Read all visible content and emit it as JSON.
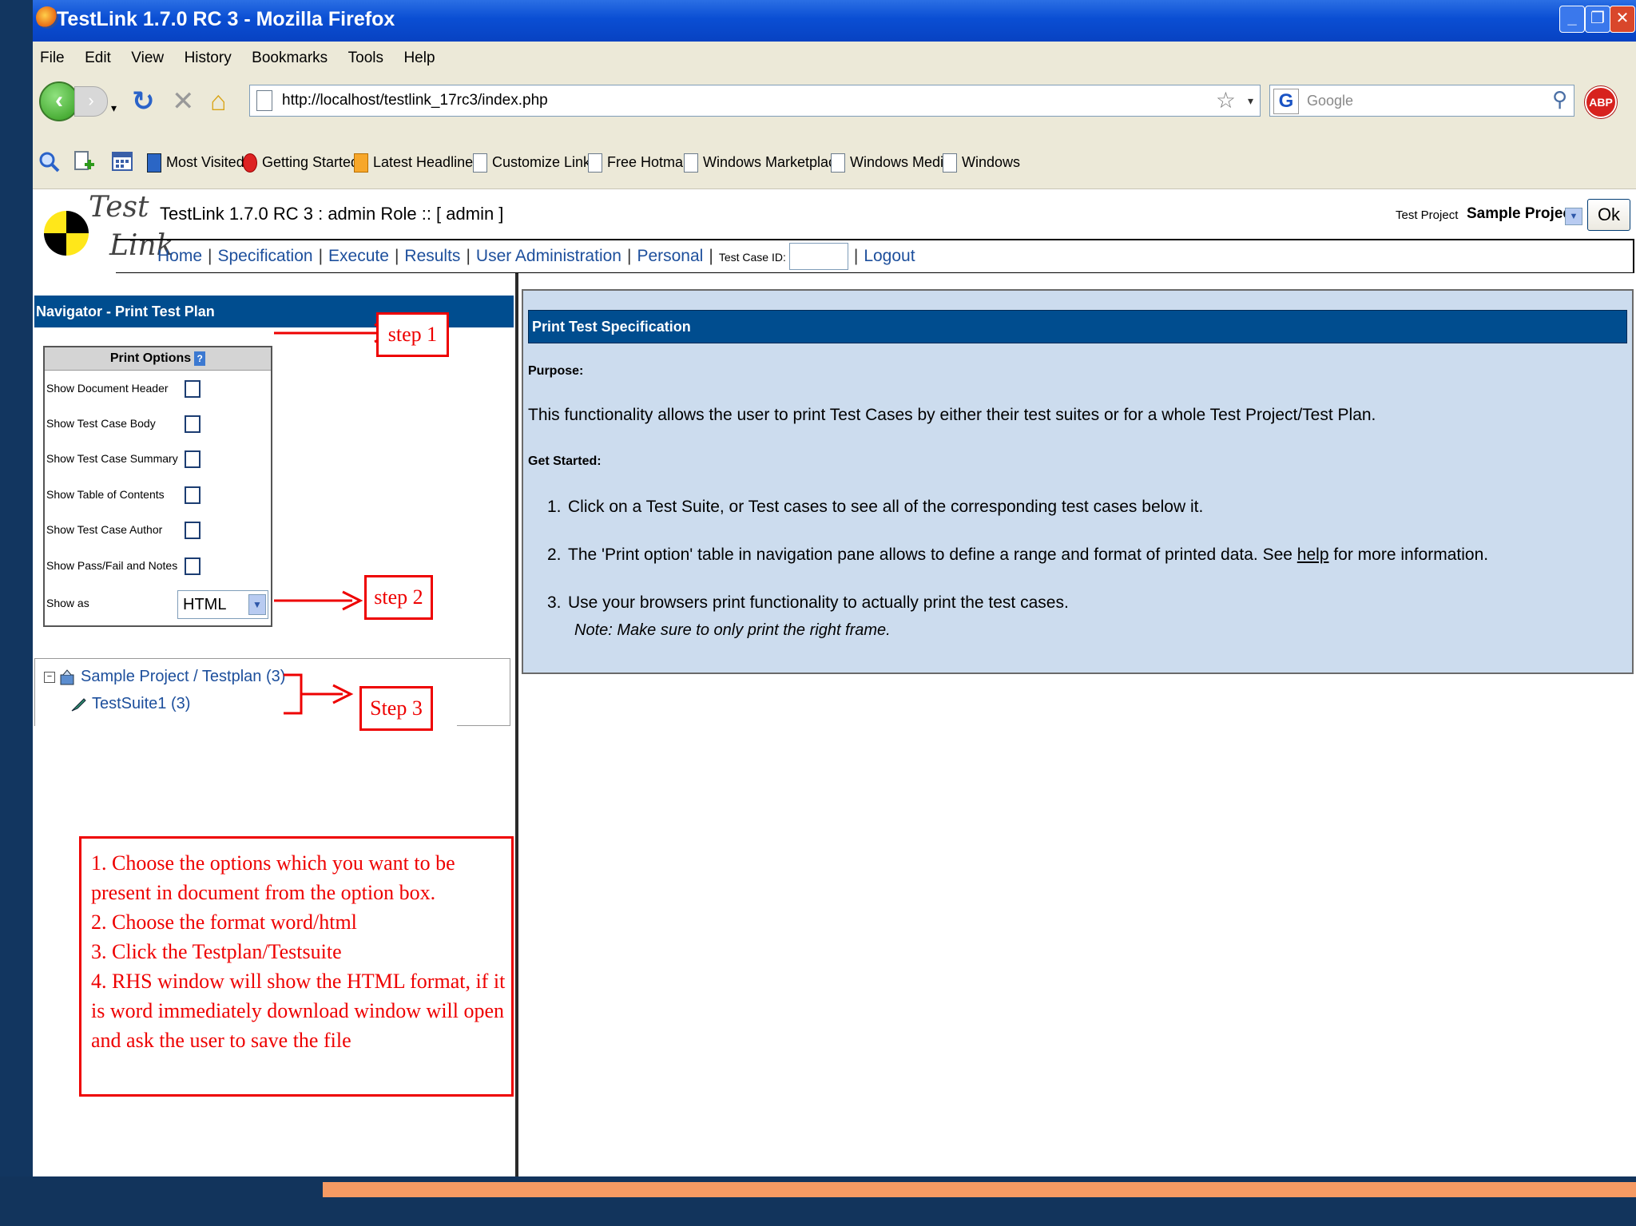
{
  "window": {
    "title": "TestLink 1.7.0 RC 3 - Mozilla Firefox"
  },
  "menubar": [
    "File",
    "Edit",
    "View",
    "History",
    "Bookmarks",
    "Tools",
    "Help"
  ],
  "navbar": {
    "url": "http://localhost/testlink_17rc3/index.php",
    "search_placeholder": "Google",
    "abp_label": "ABP"
  },
  "bookmarks": [
    "Most Visited",
    "Getting Started",
    "Latest Headlines",
    "Customize Links",
    "Free Hotmail",
    "Windows Marketplace",
    "Windows Media",
    "Windows"
  ],
  "testlink": {
    "logo_line1": "Test",
    "logo_line2": "Link",
    "title": "TestLink 1.7.0 RC 3 : admin Role :: [ admin ]",
    "test_project_label": "Test Project",
    "test_project_value": "Sample Project",
    "ok_label": "Ok",
    "menu": {
      "home": "Home",
      "specification": "Specification",
      "execute": "Execute",
      "results": "Results",
      "user_admin": "User Administration",
      "personal": "Personal",
      "test_case_id": "Test Case ID:",
      "logout": "Logout"
    }
  },
  "navigator": {
    "header": "Navigator - Print Test Plan",
    "print_options_title": "Print Options",
    "print_options_help": "?",
    "options": [
      {
        "label": "Show Document Header",
        "checked": false
      },
      {
        "label": "Show Test Case Body",
        "checked": false
      },
      {
        "label": "Show Test Case Summary",
        "checked": false
      },
      {
        "label": "Show Table of Contents",
        "checked": false
      },
      {
        "label": "Show Test Case Author",
        "checked": false
      },
      {
        "label": "Show Pass/Fail and Notes",
        "checked": false
      }
    ],
    "show_as_label": "Show as",
    "show_as_value": "HTML",
    "tree": {
      "root": "Sample Project / Testplan (3)",
      "child": "TestSuite1 (3)"
    }
  },
  "annotations": {
    "step1": "step 1",
    "step2": "step 2",
    "step3": "Step 3",
    "notes": [
      "1. Choose the options which you want to be",
      "present in document from the option box.",
      "2. Choose the format word/html",
      "3. Click the Testplan/Testsuite",
      "4. RHS window will show the HTML format, if it",
      "is word immediately download window will open",
      "and ask the user to save the file"
    ]
  },
  "spec": {
    "header": "Print Test Specification",
    "purpose_label": "Purpose",
    "purpose_text": "This functionality allows the user to print Test Cases by either their test suites or for a whole Test Project/Test Plan.",
    "get_started_label": "Get Started",
    "step1": "Click on a Test Suite, or Test cases to see all of the corresponding test cases below it.",
    "step2_pre": "The 'Print option' table in navigation pane allows to define a range and format of printed data. See",
    "step2_link": "help",
    "step2_post": "for more information.",
    "step3": "Use your browsers print functionality to actually print the test cases.",
    "step3_note": "Note: Make sure to only print the right frame."
  },
  "colors": {
    "accent": "#004d8f",
    "annotation": "#ee0000",
    "panel": "#ccdcee",
    "slide_background": "#123660",
    "slide_stripe": "#f59a63"
  }
}
